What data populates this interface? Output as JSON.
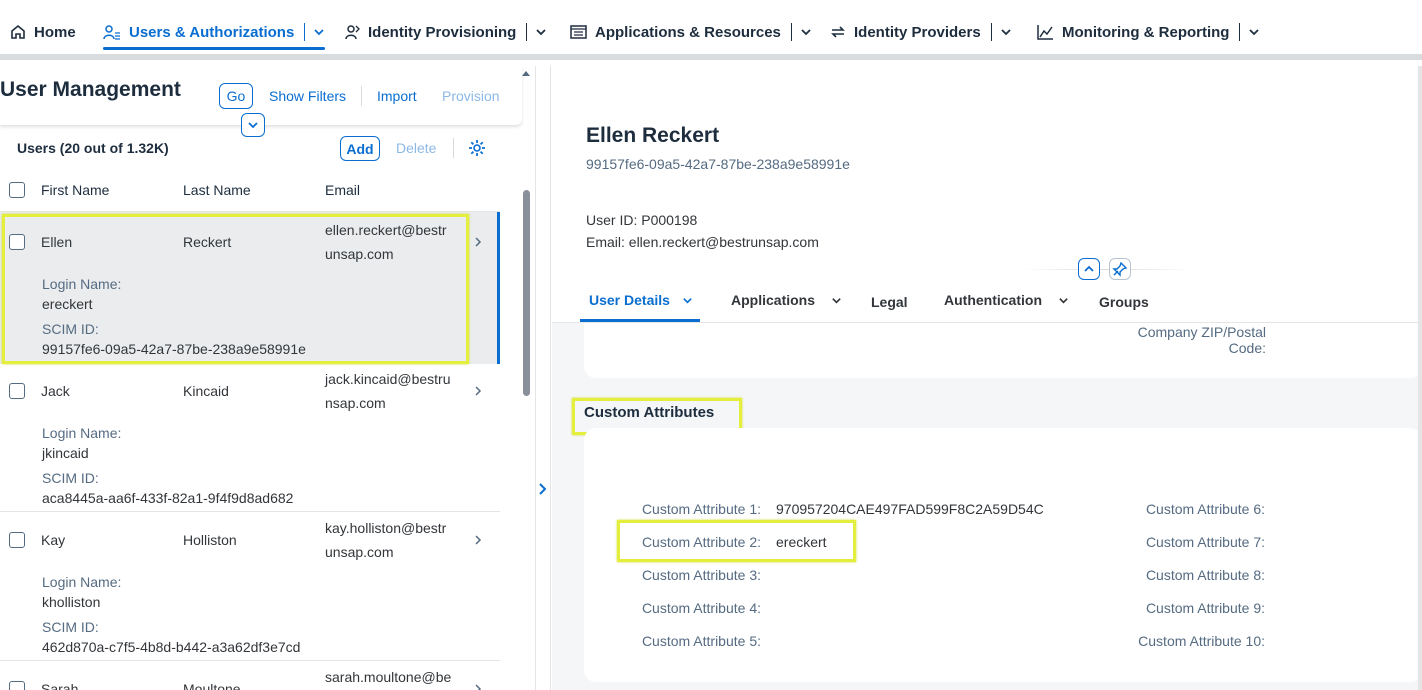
{
  "nav": {
    "home": "Home",
    "users": "Users & Authorizations",
    "provisioning": "Identity Provisioning",
    "applications": "Applications & Resources",
    "providers": "Identity Providers",
    "monitoring": "Monitoring & Reporting"
  },
  "left": {
    "title": "User Management",
    "go": "Go",
    "show_filters": "Show Filters",
    "import": "Import",
    "provision": "Provision",
    "table_title": "Users (20 out of 1.32K)",
    "add": "Add",
    "delete": "Delete",
    "columns": [
      "First Name",
      "Last Name",
      "Email"
    ],
    "login_label": "Login Name:",
    "scim_label": "SCIM ID:",
    "rows": [
      {
        "first": "Ellen",
        "last": "Reckert",
        "email1": "ellen.reckert@bestr",
        "email2": "unsap.com",
        "login": "ereckert",
        "scim": "99157fe6-09a5-42a7-87be-238a9e58991e"
      },
      {
        "first": "Jack",
        "last": "Kincaid",
        "email1": "jack.kincaid@bestru",
        "email2": "nsap.com",
        "login": "jkincaid",
        "scim": "aca8445a-aa6f-433f-82a1-9f4f9d8ad682"
      },
      {
        "first": "Kay",
        "last": "Holliston",
        "email1": "kay.holliston@bestr",
        "email2": "unsap.com",
        "login": "kholliston",
        "scim": "462d870a-c7f5-4b8d-b442-a3a62df3e7cd"
      },
      {
        "first": "Sarah",
        "last": "Moultone",
        "email1": "sarah.moultone@be",
        "email2": "",
        "login": "",
        "scim": ""
      }
    ]
  },
  "right": {
    "name": "Ellen Reckert",
    "uuid": "99157fe6-09a5-42a7-87be-238a9e58991e",
    "user_id": "User ID: P000198",
    "email": "Email: ellen.reckert@bestrunsap.com",
    "tabs": [
      "User Details",
      "Applications",
      "Legal",
      "Authentication",
      "Groups"
    ],
    "zip_label_1": "Company ZIP/Postal",
    "zip_label_2": "Code:",
    "custom_title": "Custom Attributes",
    "attrs_left": [
      {
        "label": "Custom Attribute 1:",
        "value": "970957204CAE497FAD599F8C2A59D54C"
      },
      {
        "label": "Custom Attribute 2:",
        "value": "ereckert"
      },
      {
        "label": "Custom Attribute 3:",
        "value": ""
      },
      {
        "label": "Custom Attribute 4:",
        "value": ""
      },
      {
        "label": "Custom Attribute 5:",
        "value": ""
      }
    ],
    "attrs_right": [
      {
        "label": "Custom Attribute 6:",
        "value": ""
      },
      {
        "label": "Custom Attribute 7:",
        "value": ""
      },
      {
        "label": "Custom Attribute 8:",
        "value": ""
      },
      {
        "label": "Custom Attribute 9:",
        "value": ""
      },
      {
        "label": "Custom Attribute 10:",
        "value": ""
      }
    ]
  },
  "colors": {
    "accent": "#0a6ed1",
    "highlight": "#e3ef3c",
    "selected_row": "#eaecee"
  }
}
